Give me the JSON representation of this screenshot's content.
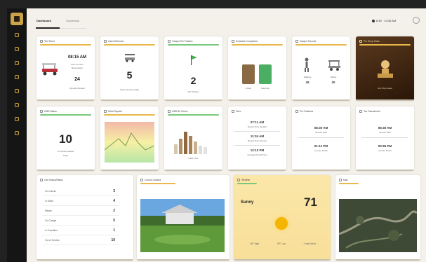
{
  "colors": {
    "accent": "#e8b84a",
    "green": "#79c97a",
    "sidebar": "#151515"
  },
  "tabs": [
    "Dashboard",
    "Scorebook"
  ],
  "clock": "8:45 · 10:36 AM",
  "sidebar_icons": [
    "home-icon",
    "cart-icon",
    "flag-icon",
    "calendar-icon",
    "users-icon",
    "chart-icon",
    "settings-icon",
    "person-icon"
  ],
  "cards": {
    "tee_sheet": {
      "title": "Tee Sheet",
      "time": "08:15 AM",
      "sub1": "Next tee time",
      "sub2": "Reservation",
      "count": "24",
      "count_label": "Rounds Booked"
    },
    "carts": {
      "title": "Carts Returned",
      "value": "5",
      "label": "Carts returned today"
    },
    "flags": {
      "title": "Today's Pin Position",
      "value": "2",
      "label": "Pin Position"
    },
    "schedule": {
      "title": "Schedule Completed",
      "a": "Friday",
      "b": "Saturday"
    },
    "players": {
      "title": "Today's Rounds",
      "walk_label": "Walking",
      "walk": "18",
      "ride_label": "Riding",
      "ride": "20"
    },
    "promo": {
      "title": "Pro Shop Sales",
      "label": "Gift Shop Sales"
    },
    "pace": {
      "title": "GMS Status",
      "value": "10",
      "label": "of rounds paused",
      "label2": "today"
    },
    "weather_map": {
      "title": "Wind Reports"
    },
    "bars": {
      "title": "GMS 60 Check",
      "label": "GMS Time"
    },
    "tees": {
      "title": "Tees",
      "t1": "07:11 AM",
      "l1": "Round Time (Golfer)",
      "t2": "11:34 AM",
      "l2": "Round Time Groups",
      "t3": "12:10 PM",
      "l3": "Average Round Time"
    },
    "pin": {
      "title": "Pin Positions",
      "t1": "08:30 AM",
      "l1": "Course Start",
      "t2": "01:11 PM",
      "l2": "Course Finish"
    },
    "tourn": {
      "title": "Tee Tournament",
      "t1": "08:30 AM",
      "l1": "Course Start",
      "t2": "09:55 PM",
      "l2": "Course Finish"
    },
    "cart_status": {
      "title": "Cart Status/Status",
      "rows": [
        {
          "label": "On Course",
          "value": "3"
        },
        {
          "label": "In Stock",
          "value": "4"
        },
        {
          "label": "Repair",
          "value": "2"
        },
        {
          "label": "On Charge",
          "value": "5"
        },
        {
          "label": "In Transition",
          "value": "1"
        },
        {
          "label": "Out of Service",
          "value": "10"
        }
      ]
    },
    "course_cam": {
      "title": "Course Camera"
    },
    "weather": {
      "title": "Weather",
      "cond": "Sunny",
      "temp": "71",
      "s1": "86°",
      "s1l": "High",
      "s2": "59°",
      "s2l": "Low",
      "s3": "7 mph",
      "s3l": "Wind"
    },
    "map": {
      "title": "Map"
    }
  }
}
